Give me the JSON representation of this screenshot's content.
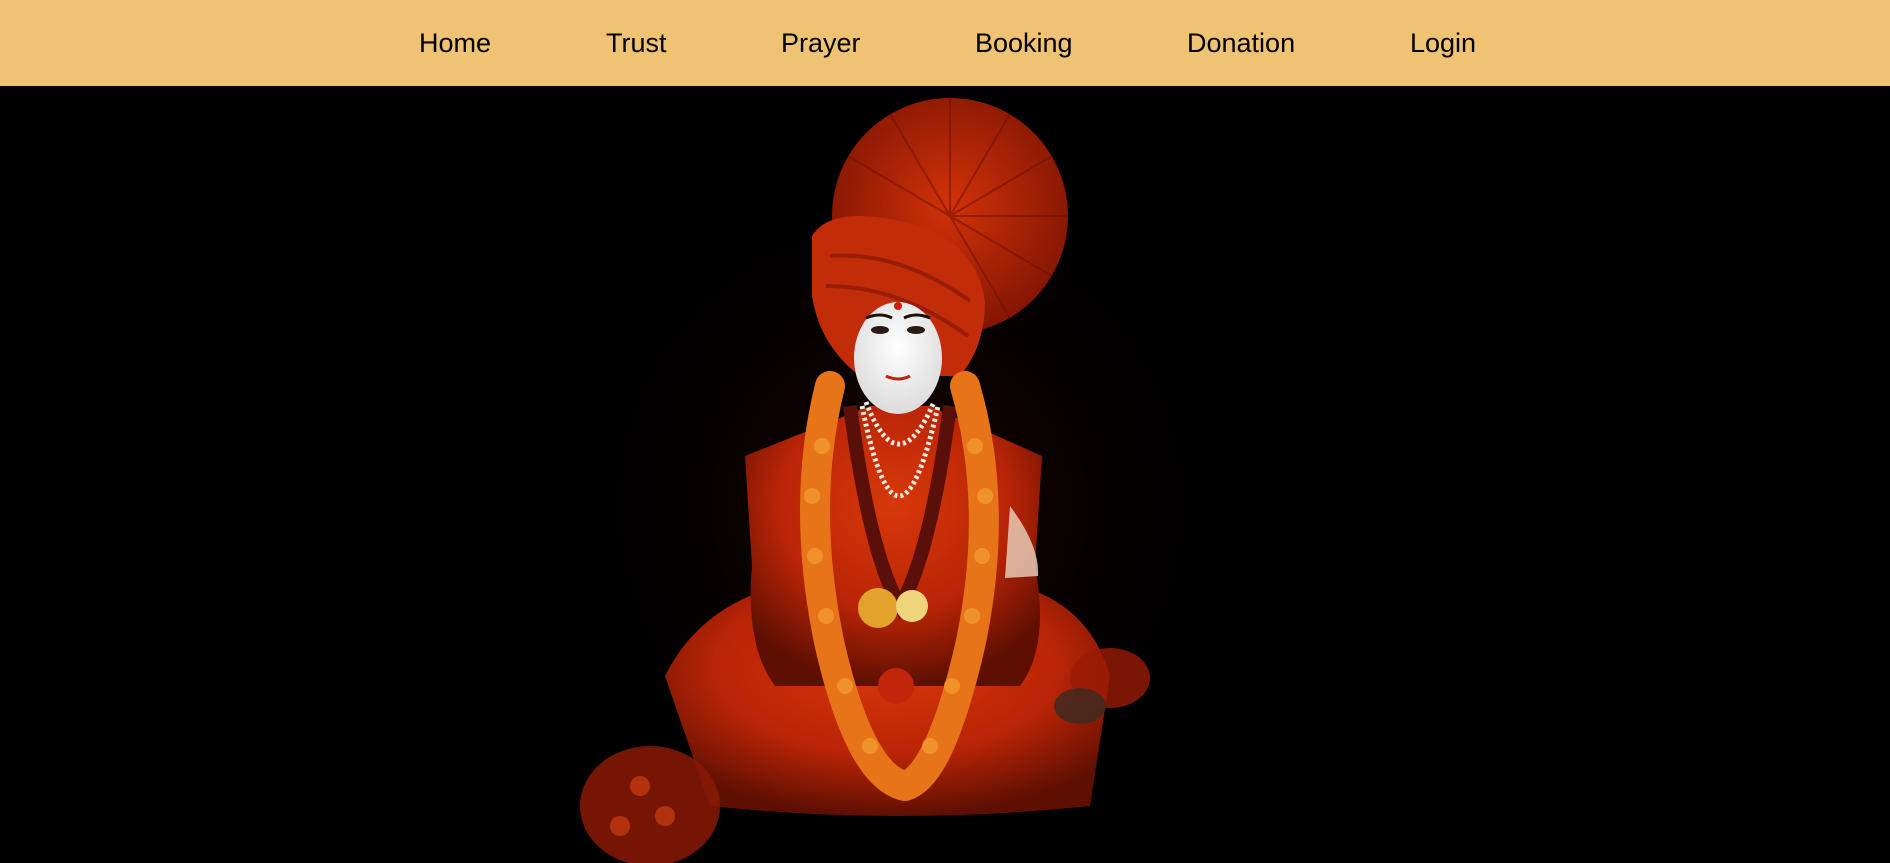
{
  "nav": {
    "items": [
      {
        "label": "Home"
      },
      {
        "label": "Trust"
      },
      {
        "label": "Prayer"
      },
      {
        "label": "Booking"
      },
      {
        "label": "Donation"
      },
      {
        "label": "Login"
      }
    ]
  },
  "colors": {
    "navbar_bg": "#efc373",
    "nav_text": "#000000",
    "page_bg": "#000000",
    "robe_red": "#c42a06",
    "marigold": "#e8741a"
  },
  "hero": {
    "image": "portrait-photo"
  }
}
